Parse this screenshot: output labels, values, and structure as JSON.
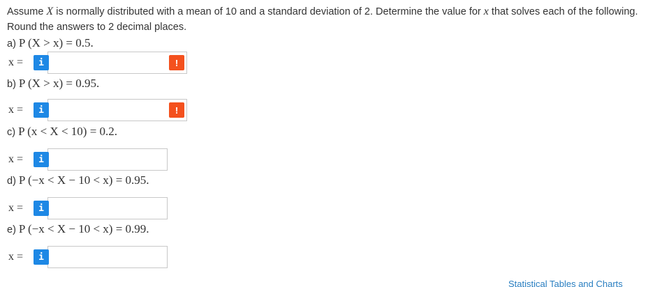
{
  "intro": {
    "part1": "Assume ",
    "var": "X",
    "part2": " is normally distributed with a mean of 10 and a standard deviation of 2. Determine the value for ",
    "var2": "x",
    "part3": " that solves each of the following. Round the answers to 2 decimal places."
  },
  "questions": [
    {
      "prefix": "a) ",
      "expr": "P (X > x) = 0.5.",
      "answer_label": "x =",
      "value": "",
      "warning": "!"
    },
    {
      "prefix": "b) ",
      "expr": "P (X > x) = 0.95.",
      "answer_label": "x =",
      "value": "",
      "warning": "!"
    },
    {
      "prefix": "c) ",
      "expr": "P (x < X < 10) = 0.2.",
      "answer_label": "x =",
      "value": ""
    },
    {
      "prefix": "d) ",
      "expr": "P (−x < X − 10 < x) = 0.95.",
      "answer_label": "x =",
      "value": ""
    },
    {
      "prefix": "e) ",
      "expr": "P (−x < X − 10 < x) = 0.99.",
      "answer_label": "x =",
      "value": ""
    }
  ],
  "info_icon_glyph": "i",
  "footer_link": "Statistical Tables and Charts",
  "colors": {
    "info": "#1e88e5",
    "warning": "#f4511e",
    "link": "#2a7fc1",
    "text": "#333333"
  }
}
